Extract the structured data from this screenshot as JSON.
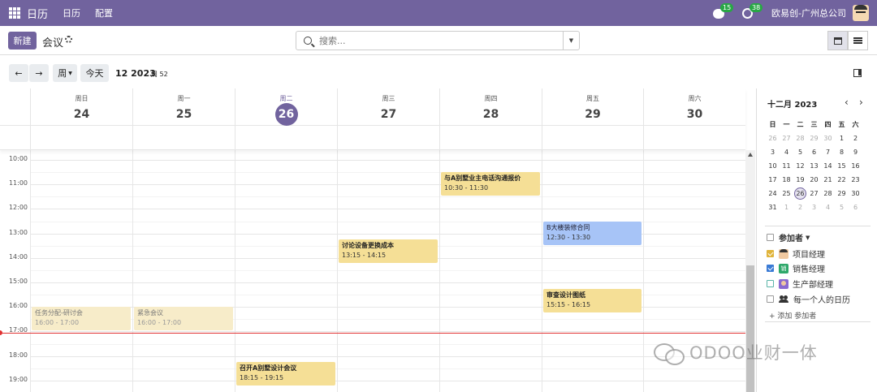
{
  "topbar": {
    "app_name": "日历",
    "menu": [
      "日历",
      "配置"
    ],
    "messages_count": "15",
    "activities_count": "38",
    "company": "欧易创-广州总公司"
  },
  "control": {
    "new_label": "新建",
    "title": "会议",
    "search_placeholder": "搜索..."
  },
  "nav": {
    "today_label": "今天",
    "scale_label": "周",
    "date_label": "12 2023",
    "week_label": "周 52"
  },
  "days": [
    {
      "name": "周日",
      "num": "24"
    },
    {
      "name": "周一",
      "num": "25"
    },
    {
      "name": "周二",
      "num": "26"
    },
    {
      "name": "周三",
      "num": "27"
    },
    {
      "name": "周四",
      "num": "28"
    },
    {
      "name": "周五",
      "num": "29"
    },
    {
      "name": "周六",
      "num": "30"
    }
  ],
  "hours": [
    "10:00",
    "11:00",
    "12:00",
    "13:00",
    "14:00",
    "15:00",
    "16:00",
    "17:00",
    "18:00",
    "19:00"
  ],
  "events": [
    {
      "title": "与A别墅业主电话沟通报价",
      "time": "10:30 - 11:30",
      "day": 4,
      "start": 10.5,
      "end": 11.5,
      "color": "yellow"
    },
    {
      "title": "B大楼装修合同",
      "time": "12:30 - 13:30",
      "day": 5,
      "start": 12.5,
      "end": 13.5,
      "color": "blue"
    },
    {
      "title": "讨论设备更换成本",
      "time": "13:15 - 14:15",
      "day": 3,
      "start": 13.25,
      "end": 14.25,
      "color": "yellow"
    },
    {
      "title": "审查设计图纸",
      "time": "15:15 - 16:15",
      "day": 5,
      "start": 15.25,
      "end": 16.25,
      "color": "yellow"
    },
    {
      "title": "任务分配-研讨会",
      "time": "16:00 - 17:00",
      "day": 0,
      "start": 16,
      "end": 17,
      "color": "pale"
    },
    {
      "title": "紧急会议",
      "time": "16:00 - 17:00",
      "day": 1,
      "start": 16,
      "end": 17,
      "color": "pale"
    },
    {
      "title": "召开A别墅设计会议",
      "time": "18:15 - 19:15",
      "day": 2,
      "start": 18.25,
      "end": 19.25,
      "color": "yellow"
    }
  ],
  "mini": {
    "title": "十二月 2023",
    "weekdays": [
      "日",
      "一",
      "二",
      "三",
      "四",
      "五",
      "六"
    ],
    "weeks": [
      [
        [
          "26",
          1
        ],
        [
          "27",
          1
        ],
        [
          "28",
          1
        ],
        [
          "29",
          1
        ],
        [
          "30",
          1
        ],
        [
          "1",
          0
        ],
        [
          "2",
          0
        ]
      ],
      [
        [
          "3",
          0
        ],
        [
          "4",
          0
        ],
        [
          "5",
          0
        ],
        [
          "6",
          0
        ],
        [
          "7",
          0
        ],
        [
          "8",
          0
        ],
        [
          "9",
          0
        ]
      ],
      [
        [
          "10",
          0
        ],
        [
          "11",
          0
        ],
        [
          "12",
          0
        ],
        [
          "13",
          0
        ],
        [
          "14",
          0
        ],
        [
          "15",
          0
        ],
        [
          "16",
          0
        ]
      ],
      [
        [
          "17",
          0
        ],
        [
          "18",
          0
        ],
        [
          "19",
          0
        ],
        [
          "20",
          0
        ],
        [
          "21",
          0
        ],
        [
          "22",
          0
        ],
        [
          "23",
          0
        ]
      ],
      [
        [
          "24",
          0
        ],
        [
          "25",
          0
        ],
        [
          "26",
          2
        ],
        [
          "27",
          0
        ],
        [
          "28",
          0
        ],
        [
          "29",
          0
        ],
        [
          "30",
          0
        ]
      ],
      [
        [
          "31",
          0
        ],
        [
          "1",
          1
        ],
        [
          "2",
          1
        ],
        [
          "3",
          1
        ],
        [
          "4",
          1
        ],
        [
          "5",
          1
        ],
        [
          "6",
          1
        ]
      ]
    ]
  },
  "attendees": {
    "header": "参加者",
    "items": [
      {
        "name": "项目经理"
      },
      {
        "name": "销售经理"
      },
      {
        "name": "生产部经理"
      },
      {
        "name": "每一个人的日历"
      }
    ],
    "add_label": "+ 添加 参加者"
  },
  "watermark": "ODOO业财一体",
  "colors": {
    "brand": "#71639e",
    "yellow": "#f5df96",
    "blue": "#a7c4f7",
    "now": "#e03131"
  }
}
